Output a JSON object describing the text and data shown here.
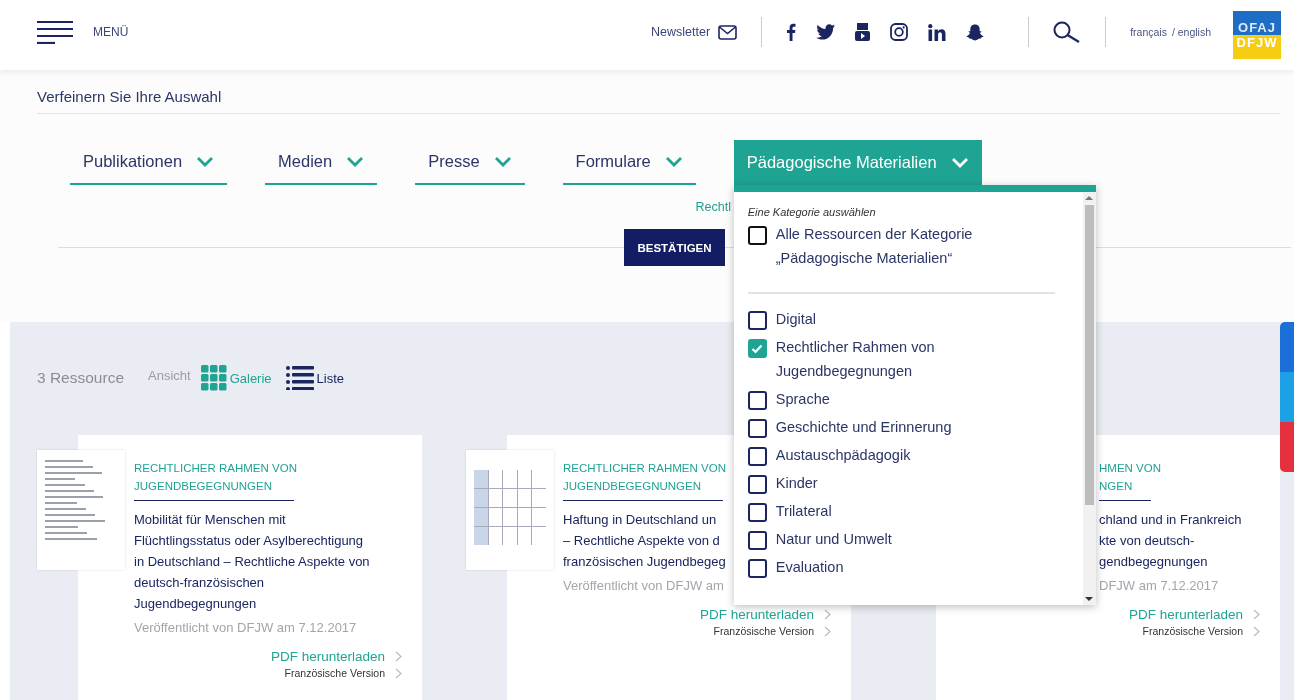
{
  "header": {
    "menu_label": "MENÜ",
    "newsletter": "Newsletter",
    "languages": [
      {
        "label": "français",
        "selected": false
      },
      {
        "label": "/ english",
        "selected": false
      }
    ],
    "logo": {
      "top": "OFAJ",
      "bottom": "DFJW"
    }
  },
  "refine": {
    "title": "Verfeinern Sie Ihre Auswahl",
    "filters": [
      {
        "label": "Publikationen",
        "selected": false
      },
      {
        "label": "Medien",
        "selected": false
      },
      {
        "label": "Presse",
        "selected": false
      },
      {
        "label": "Formulare",
        "selected": false
      },
      {
        "label": "Pädagogische Materialien",
        "selected": true
      }
    ],
    "active_chip": "Rechtl",
    "confirm": "BESTÄTIGEN"
  },
  "dropdown": {
    "hint": "Eine Kategorie auswählen",
    "all": {
      "label": "Alle Ressourcen der Kategorie „Pädagogische Materialien“",
      "checked": false
    },
    "options": [
      {
        "label": "Digital",
        "checked": false
      },
      {
        "label": "Rechtlicher Rahmen von Jugendbegegnungen",
        "checked": true
      },
      {
        "label": "Sprache",
        "checked": false
      },
      {
        "label": "Geschichte und Erinnerung",
        "checked": false
      },
      {
        "label": "Austauschpädagogik",
        "checked": false
      },
      {
        "label": "Kinder",
        "checked": false
      },
      {
        "label": "Trilateral",
        "checked": false
      },
      {
        "label": "Natur und Umwelt",
        "checked": false
      },
      {
        "label": "Evaluation",
        "checked": false
      }
    ]
  },
  "results": {
    "count": "3 Ressource",
    "view_label": "Ansicht",
    "views": [
      {
        "label": "Galerie",
        "kind": "grid",
        "selected": true
      },
      {
        "label": "Liste",
        "kind": "list",
        "selected": false
      }
    ]
  },
  "cards": [
    {
      "kind": "text",
      "category_lines": [
        "RECHTLICHER RAHMEN VON",
        "JUGENDBEGEGNUNGEN"
      ],
      "title_lines": [
        "Mobilität für Menschen mit",
        "Flüchtlingsstatus oder Asylberechtigung",
        "in Deutschland – Rechtliche Aspekte von",
        "deutsch-französischen",
        "Jugendbegegnungen"
      ],
      "meta": "Veröffentlicht von DFJW am 7.12.2017",
      "download": "PDF herunterladen",
      "french": "Französische Version"
    },
    {
      "kind": "table",
      "category_lines": [
        "RECHTLICHER RAHMEN VON",
        "JUGENDBEGEGNUNGEN"
      ],
      "title_lines": [
        "Haftung in Deutschland un",
        "– Rechtliche Aspekte von d",
        "französischen Jugendbegeg"
      ],
      "meta": "Veröffentlicht von DFJW am",
      "download": "PDF herunterladen",
      "french": "Französische Version"
    },
    {
      "kind": "covered",
      "category_lines": [
        "HMEN VON",
        "NGEN"
      ],
      "title_lines": [
        "chland und in Frankreich",
        "kte von deutsch-",
        "gendbegegnungen"
      ],
      "meta": "DFJW am 7.12.2017",
      "download": "PDF herunterladen",
      "french": "Französische Version"
    }
  ]
}
